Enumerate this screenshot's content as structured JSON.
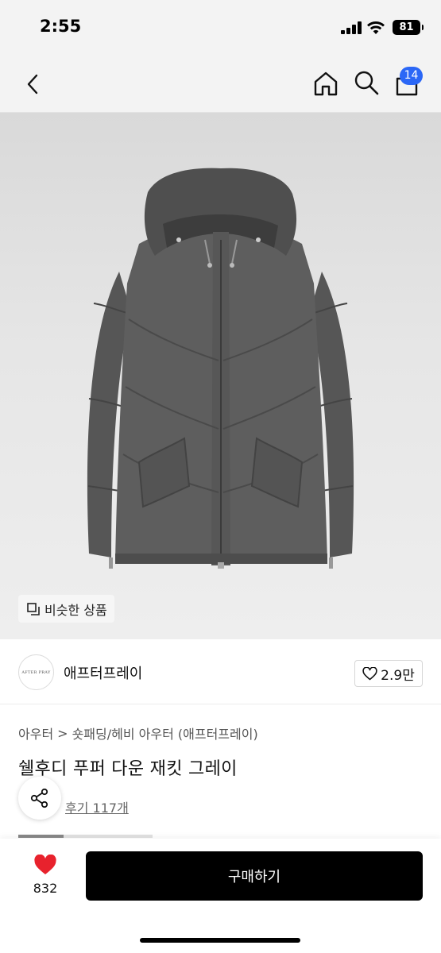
{
  "status_bar": {
    "time": "2:55",
    "battery": "81"
  },
  "nav": {
    "cart_count": "14"
  },
  "image": {
    "similar_label": "비슷한 상품"
  },
  "brand": {
    "logo_text": "AFTER PRAY",
    "name": "애프터프레이",
    "likes": "2.9만"
  },
  "breadcrumb": {
    "level1": "아우터",
    "separator": ">",
    "level2": "숏패딩/헤비 아우터 (애프터프레이)"
  },
  "product": {
    "title": "쉘후디 푸퍼 다운 재킷 그레이",
    "review_link": "후기 117개"
  },
  "bottom": {
    "wish_count": "832",
    "buy_label": "구매하기"
  },
  "colors": {
    "accent_badge": "#2b67f6",
    "heart": "#e8222d",
    "buy_button": "#000000"
  }
}
